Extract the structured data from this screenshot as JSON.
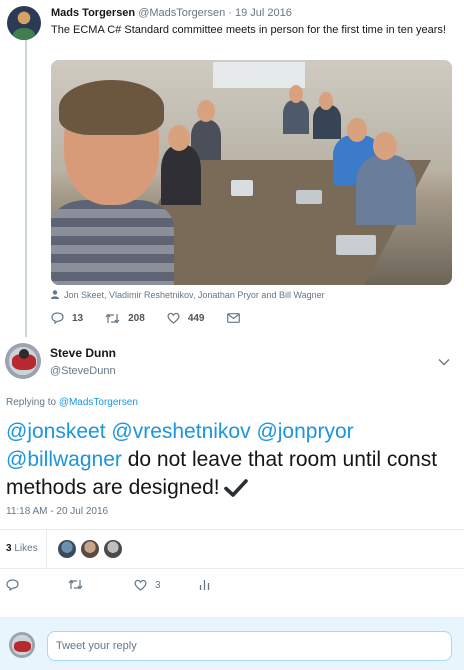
{
  "quoted_tweet": {
    "name": "Mads Torgersen",
    "handle": "@MadsTorgersen",
    "separator": "·",
    "date": "19 Jul 2016",
    "text": "The ECMA C# Standard committee meets in person for the first time in ten years!",
    "media_caption": "Jon Skeet, Vladimir Reshetnikov, Jonathan Pryor and Bill Wagner",
    "reply_count": "13",
    "retweet_count": "208",
    "like_count": "449"
  },
  "main_tweet": {
    "name": "Steve Dunn",
    "handle": "@SteveDunn",
    "replying_to_prefix": "Replying to",
    "replying_to_handle": "@MadsTorgersen",
    "mentions": [
      "@jonskeet",
      "@vreshetnikov",
      "@jonpryor",
      "@billwagner"
    ],
    "body_text": "do not leave that room until const methods are designed!",
    "emoji": "heavy-check-mark",
    "timestamp": "11:18 AM - 20 Jul 2016",
    "likes_number": "3",
    "likes_label": "Likes",
    "action_like_count": "3"
  },
  "reply_box": {
    "placeholder": "Tweet your reply"
  },
  "colors": {
    "link": "#1b95e0",
    "secondary_text": "#657786",
    "primary_text": "#14171a",
    "reply_bg": "#e8f5fd",
    "divider": "#e6ecf0"
  },
  "icons": [
    "reply-icon",
    "retweet-icon",
    "like-icon",
    "dm-icon",
    "analytics-icon",
    "caret-down-icon",
    "person-icon",
    "check-mark-icon"
  ]
}
